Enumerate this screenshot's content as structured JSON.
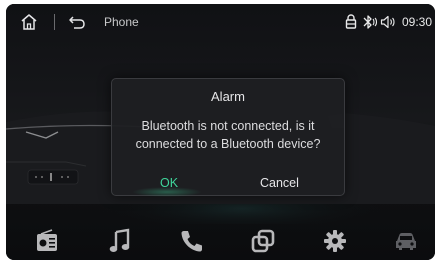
{
  "status_bar": {
    "app_title": "Phone",
    "time": "09:30",
    "icons": [
      "home-icon",
      "back-icon",
      "lock-icon",
      "bluetooth-icon",
      "volume-icon"
    ]
  },
  "dialog": {
    "title": "Alarm",
    "message_line1": "Bluetooth is not connected, is it",
    "message_line2": "connected to a Bluetooth device?",
    "ok_label": "OK",
    "cancel_label": "Cancel"
  },
  "dock": {
    "items": [
      {
        "icon": "radio-icon"
      },
      {
        "icon": "music-icon"
      },
      {
        "icon": "phone-icon"
      },
      {
        "icon": "apps-icon"
      },
      {
        "icon": "settings-icon"
      },
      {
        "icon": "car-icon"
      }
    ]
  },
  "colors": {
    "background": "#0d0e10",
    "dialog_bg": "#1e1f22",
    "ok_accent": "#3fd49a",
    "text": "#e6e6e8",
    "dock_icon": "#b8b8ba"
  }
}
